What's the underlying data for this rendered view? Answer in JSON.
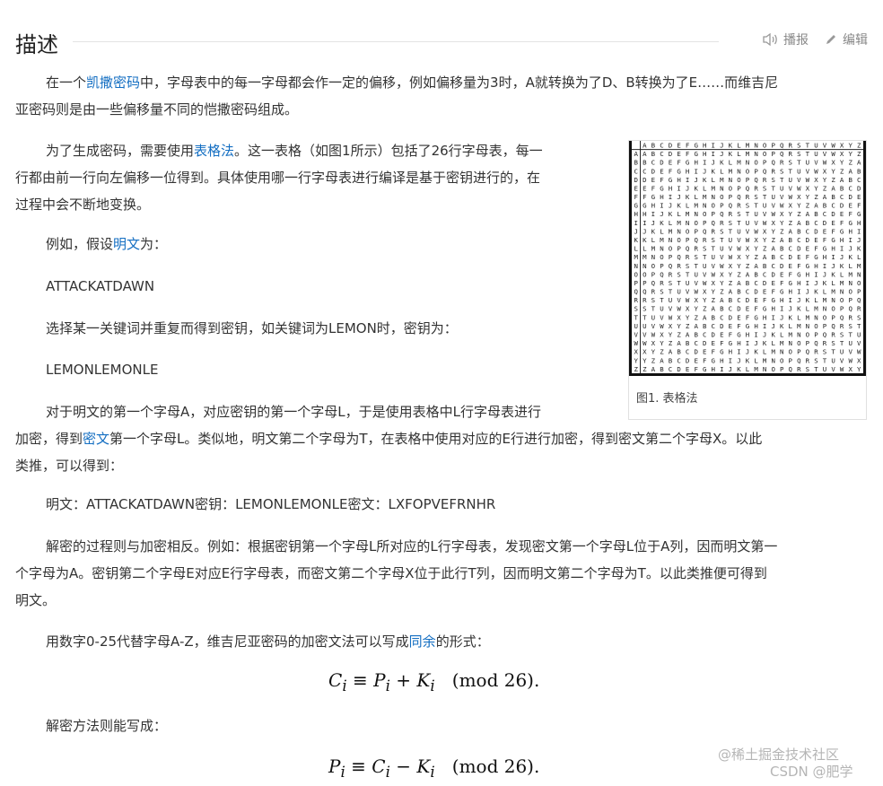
{
  "header": {
    "title": "描述",
    "play_label": "播报",
    "edit_label": "编辑"
  },
  "intro": {
    "a": "在一个",
    "link": "凯撒密码",
    "b": "中，字母表中的每一字母都会作一定的偏移，例如偏移量为3时，A就转换为了D、B转换为了E……而维吉尼",
    "line2": "亚密码则是由一些偏移量不同的恺撒密码组成。"
  },
  "table_para": {
    "a": "为了生成密码，需要使用",
    "link": "表格法",
    "b": "。这一表格（如图1所示）包括了26行字母表，每一",
    "line2": "行都由前一行向左偏移一位得到。具体使用哪一行字母表进行编译是基于密钥进行的，在",
    "line3": "过程中会不断地变换。"
  },
  "example": {
    "a": "例如，假设",
    "link": "明文",
    "b": "为："
  },
  "plaintext": "ATTACKATDAWN",
  "key_intro": "选择某一关键词并重复而得到密钥，如关键词为LEMON时，密钥为：",
  "key": "LEMONLEMONLE",
  "process": {
    "line1": "对于明文的第一个字母A，对应密钥的第一个字母L，于是使用表格中L行字母表进行",
    "a": "加密，得到",
    "link": "密文",
    "b": "第一个字母L。类似地，明文第二个字母为T，在表格中使用对应的E行进行加密，得到密文第二个字母X。以此",
    "line3": "类推，可以得到："
  },
  "summary": "明文：ATTACKATDAWN密钥：LEMONLEMONLE密文：LXFOPVEFRNHR",
  "decrypt": {
    "line1": "解密的过程则与加密相反。例如：根据密钥第一个字母L所对应的L行字母表，发现密文第一个字母L位于A列，因而明文第一",
    "line2": "个字母为A。密钥第二个字母E对应E行字母表，而密文第二个字母X位于此行T列，因而明文第二个字母为T。以此类推便可得到",
    "line3": "明文。"
  },
  "congruence": {
    "a": "用数字0-25代替字母A-Z，维吉尼亚密码的加密文法可以写成",
    "link": "同余",
    "b": "的形式："
  },
  "enc_formula": {
    "lhs": "C",
    "lhs_sub": "i",
    "op": "≡",
    "p": "P",
    "p_sub": "i",
    "plus": "+",
    "k": "K",
    "k_sub": "i",
    "mod": "(mod 26)."
  },
  "decrypt_intro": "解密方法则能写成：",
  "dec_formula": {
    "lhs": "P",
    "lhs_sub": "i",
    "op": "≡",
    "c": "C",
    "c_sub": "i",
    "minus": "−",
    "k": "K",
    "k_sub": "i",
    "mod": "(mod 26)."
  },
  "figure": {
    "caption": "图1. 表格法",
    "header_row": "ABCDEFGHIJKLMNOPQRSTUVWXYZ"
  },
  "watermark": {
    "line1": "@稀土掘金技术社区",
    "line2": "CSDN @肥学"
  },
  "colors": {
    "link": "#136ec2",
    "text": "#333333"
  }
}
